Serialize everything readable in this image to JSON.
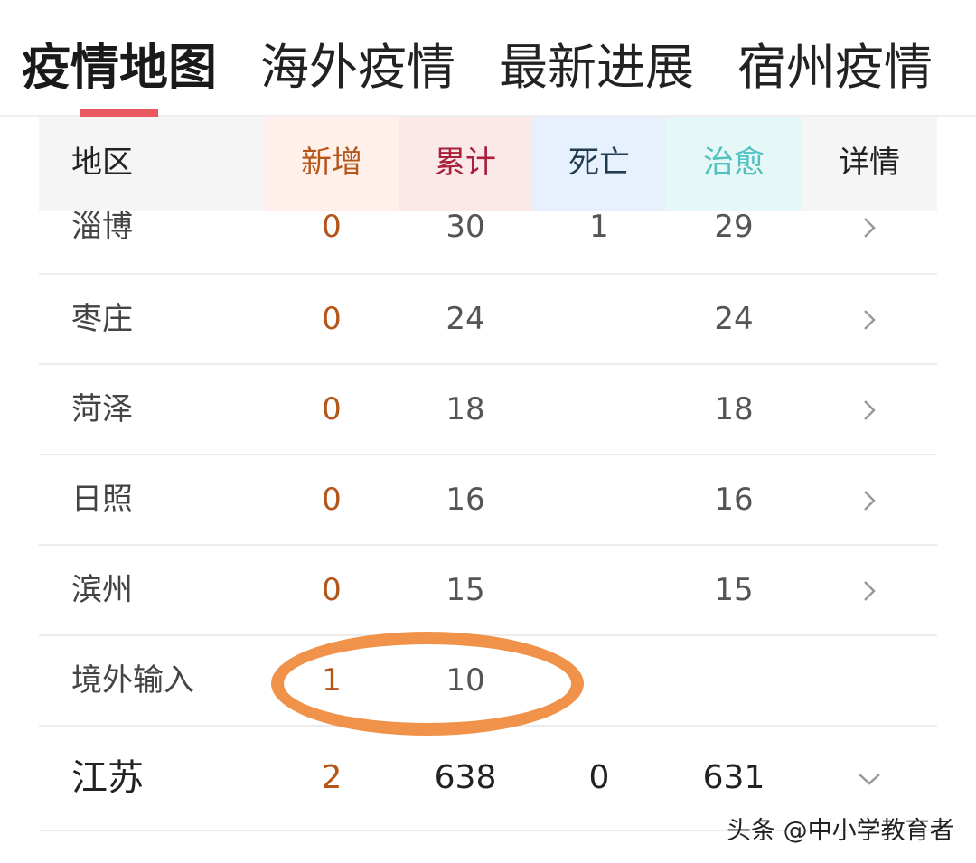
{
  "tabs": [
    {
      "label": "疫情地图",
      "active": true
    },
    {
      "label": "海外疫情",
      "active": false
    },
    {
      "label": "最新进展",
      "active": false
    },
    {
      "label": "宿州疫情",
      "active": false
    }
  ],
  "colors": {
    "tab_indicator": "#e85a5f",
    "new": "#b4551a",
    "total": "#a8203a",
    "death": "#1f3b50",
    "recovered": "#4fc1c0",
    "annotation": "#f0924a"
  },
  "table": {
    "headers": {
      "region": "地区",
      "new": "新增",
      "total": "累计",
      "death": "死亡",
      "recovered": "治愈",
      "detail": "详情"
    },
    "rows": [
      {
        "region": "淄博",
        "new": "0",
        "total": "30",
        "death": "1",
        "recovered": "29",
        "has_detail": true
      },
      {
        "region": "枣庄",
        "new": "0",
        "total": "24",
        "death": "",
        "recovered": "24",
        "has_detail": true
      },
      {
        "region": "菏泽",
        "new": "0",
        "total": "18",
        "death": "",
        "recovered": "18",
        "has_detail": true
      },
      {
        "region": "日照",
        "new": "0",
        "total": "16",
        "death": "",
        "recovered": "16",
        "has_detail": true
      },
      {
        "region": "滨州",
        "new": "0",
        "total": "15",
        "death": "",
        "recovered": "15",
        "has_detail": true
      },
      {
        "region": "境外输入",
        "new": "1",
        "total": "10",
        "death": "",
        "recovered": "",
        "has_detail": false
      }
    ],
    "province": {
      "region": "江苏",
      "new": "2",
      "total": "638",
      "death": "0",
      "recovered": "631",
      "expand_icon": "chevron-down-icon"
    }
  },
  "watermark": "头条 @中小学教育者"
}
